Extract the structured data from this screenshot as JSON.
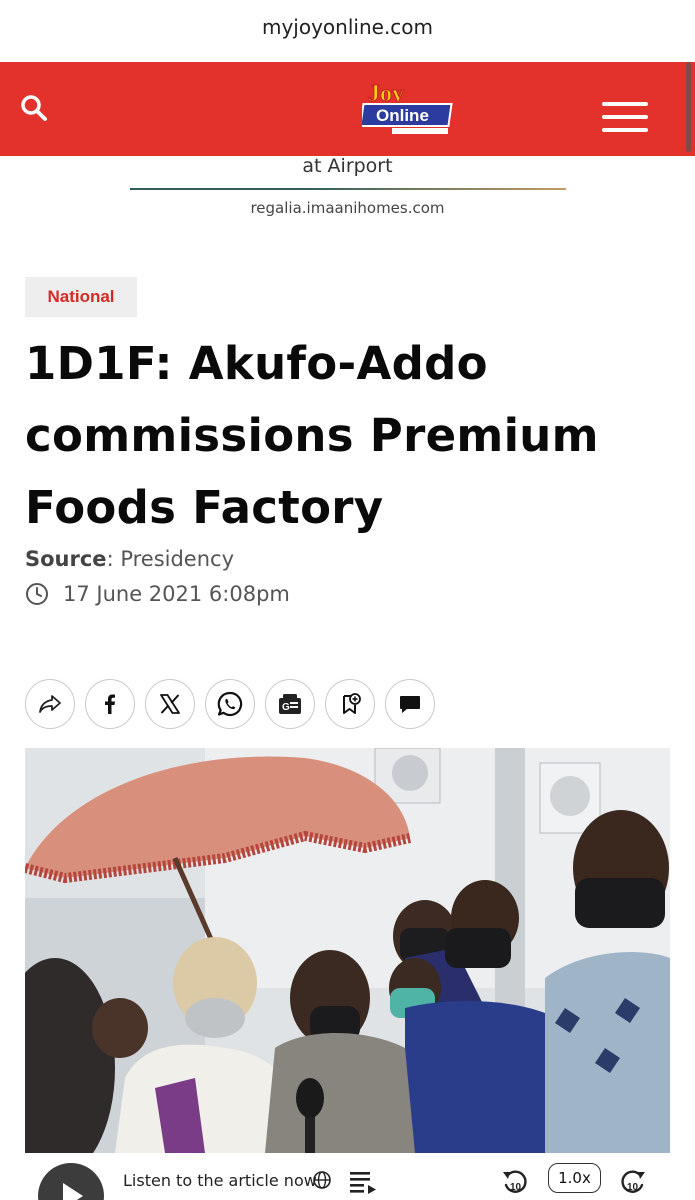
{
  "browser": {
    "url": "myjoyonline.com"
  },
  "header": {
    "logo_text_top": "Joy",
    "logo_text_bottom": "Online",
    "colors": {
      "brand_red": "#e3312b",
      "logo_blue": "#2b3b9f",
      "logo_yellow": "#f7d417"
    }
  },
  "ad": {
    "line1": "at Airport",
    "line2": "regalia.imaanihomes.com"
  },
  "article": {
    "category": "National",
    "title_lines": [
      "1D1F: Akufo-Addo",
      "commissions Premium",
      "Foods Factory"
    ],
    "source_label": "Source",
    "source_value": ": Presidency",
    "date": "17 June 2021 6:08pm"
  },
  "share": {
    "icons": [
      "share-icon",
      "facebook-icon",
      "x-icon",
      "whatsapp-icon",
      "google-news-icon",
      "bookmark-add-icon",
      "comment-icon"
    ]
  },
  "player": {
    "listen_label": "Listen to the article now",
    "speed": "1.0x",
    "skip_seconds": "10"
  }
}
